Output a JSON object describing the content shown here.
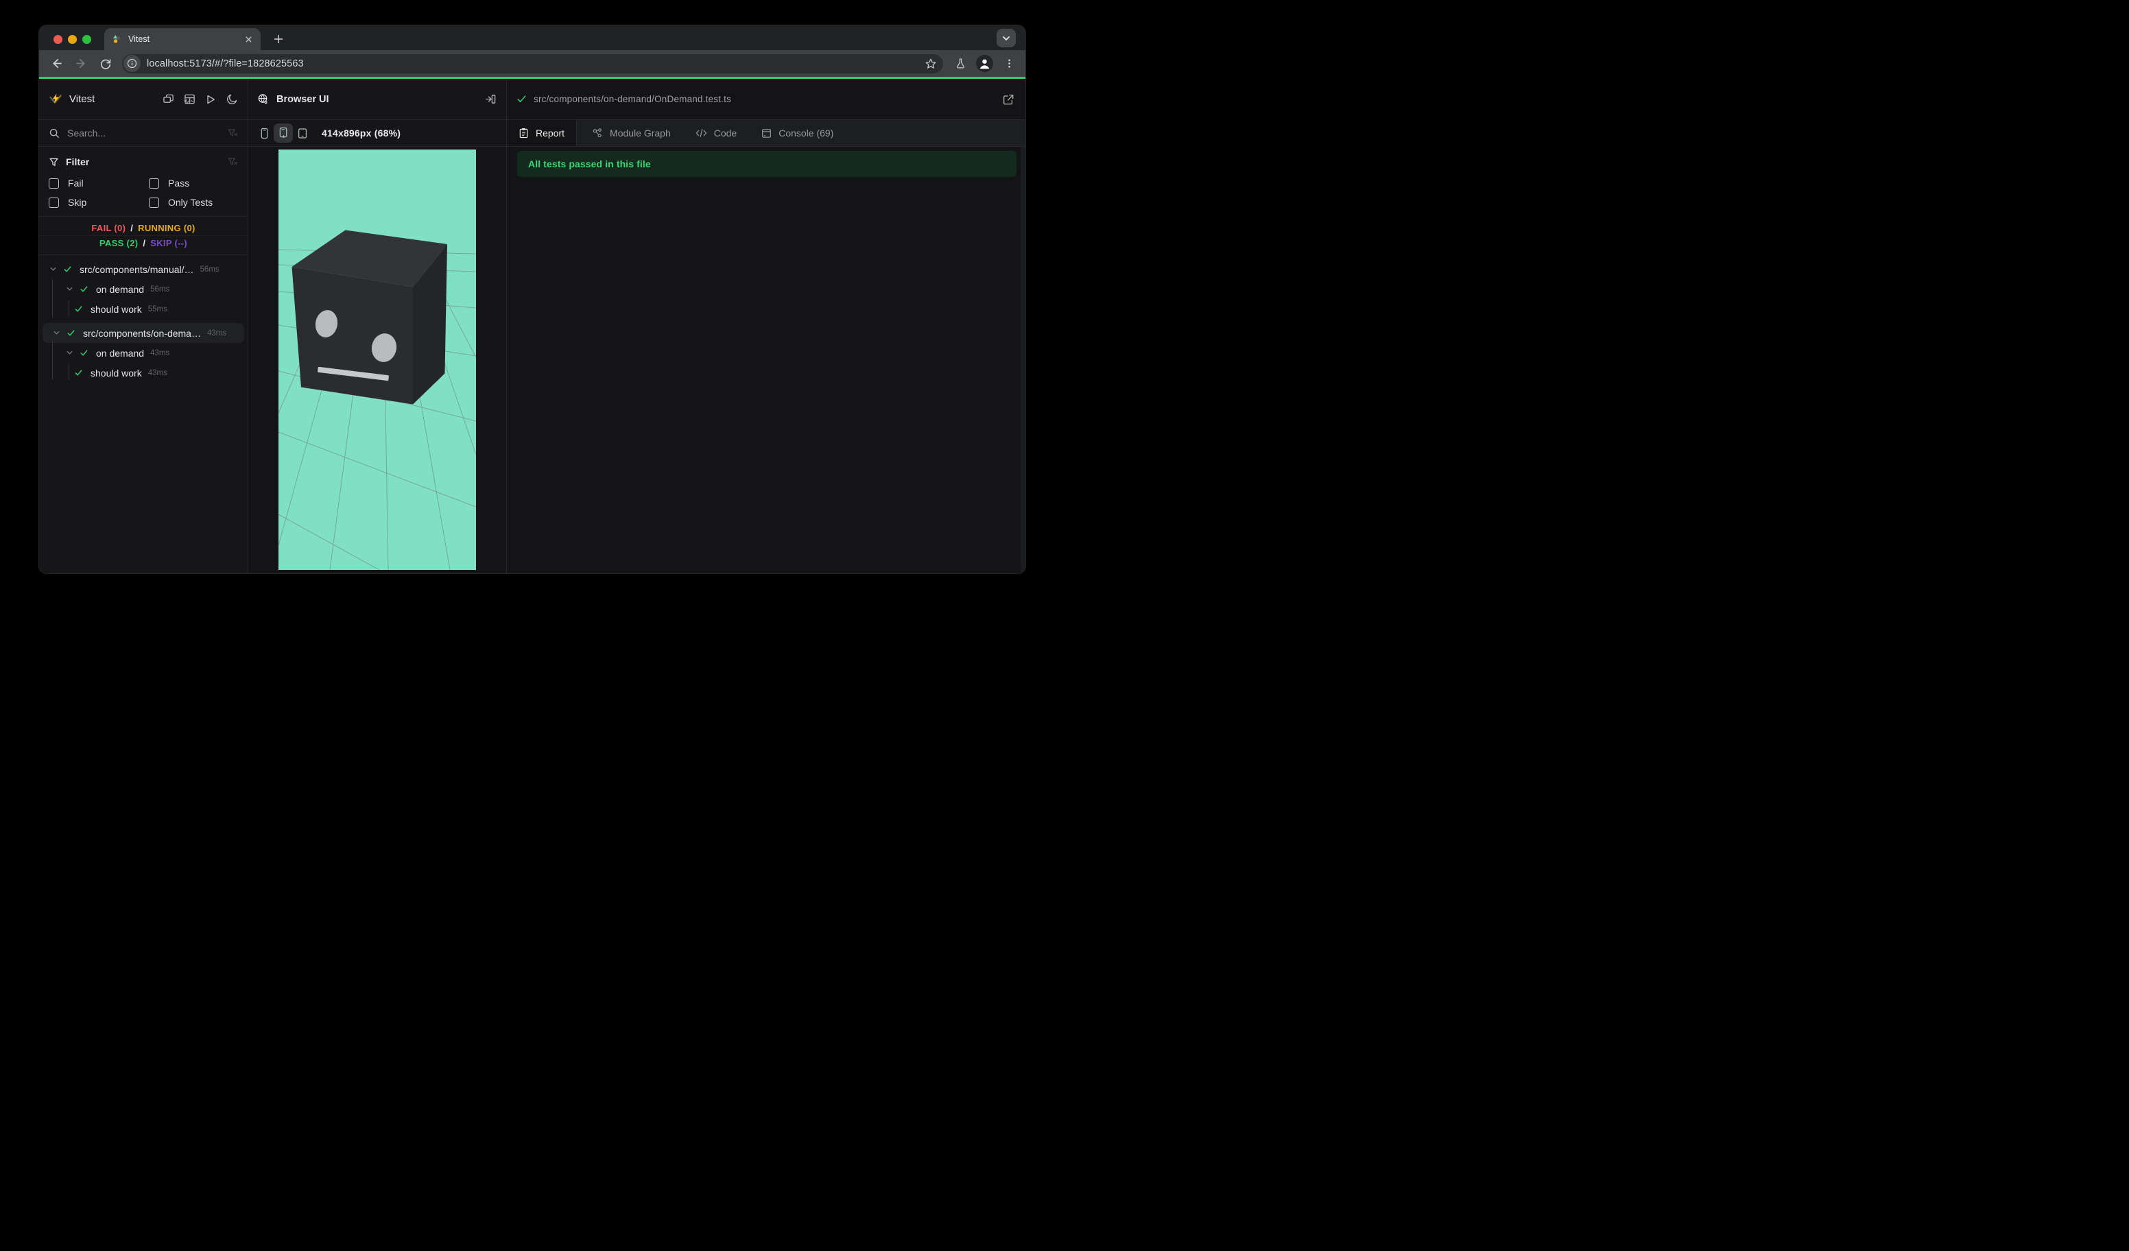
{
  "browser": {
    "tab_title": "Vitest",
    "url": "localhost:5173/#/?file=1828625563"
  },
  "sidebar": {
    "app_title": "Vitest",
    "search_placeholder": "Search...",
    "filter": {
      "title": "Filter",
      "options": [
        {
          "label": "Fail",
          "checked": false
        },
        {
          "label": "Pass",
          "checked": false
        },
        {
          "label": "Skip",
          "checked": false
        },
        {
          "label": "Only Tests",
          "checked": false
        }
      ]
    },
    "summary": {
      "fail": "FAIL (0)",
      "running": "RUNNING (0)",
      "pass": "PASS (2)",
      "skip": "SKIP (--)",
      "sep": "/"
    },
    "tree": [
      {
        "label": "src/components/manual/…",
        "duration": "56ms",
        "level": 0,
        "state": "pass"
      },
      {
        "label": "on demand",
        "duration": "56ms",
        "level": 1,
        "state": "pass"
      },
      {
        "label": "should work",
        "duration": "55ms",
        "level": 2,
        "state": "pass"
      },
      {
        "label": "src/components/on-dema…",
        "duration": "43ms",
        "level": 0,
        "state": "pass",
        "selected": true
      },
      {
        "label": "on demand",
        "duration": "43ms",
        "level": 1,
        "state": "pass"
      },
      {
        "label": "should work",
        "duration": "43ms",
        "level": 2,
        "state": "pass"
      }
    ]
  },
  "browser_panel": {
    "title": "Browser UI",
    "viewport_label": "414x896px (68%)"
  },
  "report_panel": {
    "file_path": "src/components/on-demand/OnDemand.test.ts",
    "tabs": [
      {
        "label": "Report",
        "active": true
      },
      {
        "label": "Module Graph",
        "active": false
      },
      {
        "label": "Code",
        "active": false
      },
      {
        "label": "Console (69)",
        "active": false
      }
    ],
    "banner": "All tests passed in this file"
  },
  "colors": {
    "progress_green": "#30d158",
    "pass_green": "#2fd06a",
    "fail_red": "#f25757",
    "running_yellow": "#e9ab15",
    "skip_purple": "#7a4bd0",
    "viewport_teal": "#80e0c2",
    "banner_text": "#3ed672"
  }
}
